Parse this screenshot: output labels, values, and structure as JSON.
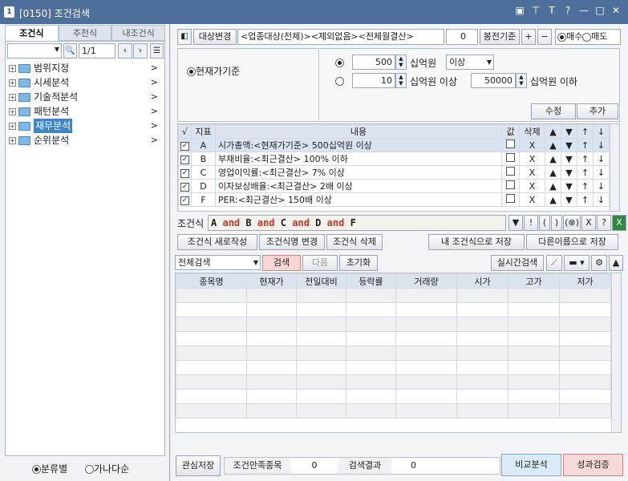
{
  "window": {
    "num": "1",
    "title": "[0150] 조건검색",
    "icons": [
      "▣",
      "⊤",
      "T",
      "?",
      "—",
      "□",
      "✕"
    ]
  },
  "left": {
    "tabs": [
      "조건식",
      "추천식",
      "내조건식"
    ],
    "page": "1/1",
    "tree": [
      "범위지정",
      "시세분석",
      "기술적분석",
      "패턴분석",
      "재무분석",
      "순위분석"
    ],
    "bottom": {
      "opt1": "분류별",
      "opt2": "가나다순"
    }
  },
  "top": {
    "target_btn": "대상변경",
    "target_text": "<업종대상(전체)><제외없음><전체월결산>",
    "bong_value": "0",
    "bong_label": "봉전기준",
    "plus": "+",
    "minus": "−",
    "buy": "매수",
    "sell": "매도"
  },
  "cond": {
    "basis": "현재가기준",
    "row1": {
      "value": "500",
      "unit": "십억원",
      "op": "이상"
    },
    "row2": {
      "value": "10",
      "unit": "십억원 이상",
      "value2": "50000",
      "unit2": "십억원 이하"
    },
    "edit": "수정",
    "add": "추가"
  },
  "ctable": {
    "headers": [
      "√",
      "지표",
      "내용",
      "값",
      "삭제",
      "▲",
      "▼",
      "↑",
      "↓"
    ],
    "rows": [
      {
        "id": "A",
        "text": "시가총액:<현재가기준> 500십억원 이상"
      },
      {
        "id": "B",
        "text": "부채비율:<최근결산> 100% 이하"
      },
      {
        "id": "C",
        "text": "영업이익률:<최근결산> 7% 이상"
      },
      {
        "id": "D",
        "text": "이자보상배율:<최근결산> 2배 이상"
      },
      {
        "id": "F",
        "text": "PER:<최근결산> 150배 이상"
      }
    ]
  },
  "formula": {
    "label": "조건식",
    "tokens": [
      "A",
      "and",
      "B",
      "and",
      "C",
      "and",
      "D",
      "and",
      "F"
    ],
    "tools": [
      "▼",
      "!",
      "(",
      ")",
      "(⊗)",
      "X",
      "?"
    ]
  },
  "actions": {
    "new": "조건식 새로작성",
    "rename": "조건식명 변경",
    "delete": "조건식 삭제",
    "save": "내 조건식으로 저장",
    "saveas": "다른이름으로 저장"
  },
  "search": {
    "scope": "전체검색",
    "search": "검색",
    "next": "다음",
    "reset": "초기화",
    "realtime": "실시간검색"
  },
  "result": {
    "headers": [
      "종목명",
      "현재가",
      "전일대비",
      "등락률",
      "거래량",
      "시가",
      "고가",
      "저가"
    ]
  },
  "footer": {
    "watch": "관심저장",
    "match_label": "조건만족종목",
    "match": "0",
    "result_label": "검색결과",
    "result": "0",
    "compare": "비교분석",
    "perf": "성과검증"
  }
}
